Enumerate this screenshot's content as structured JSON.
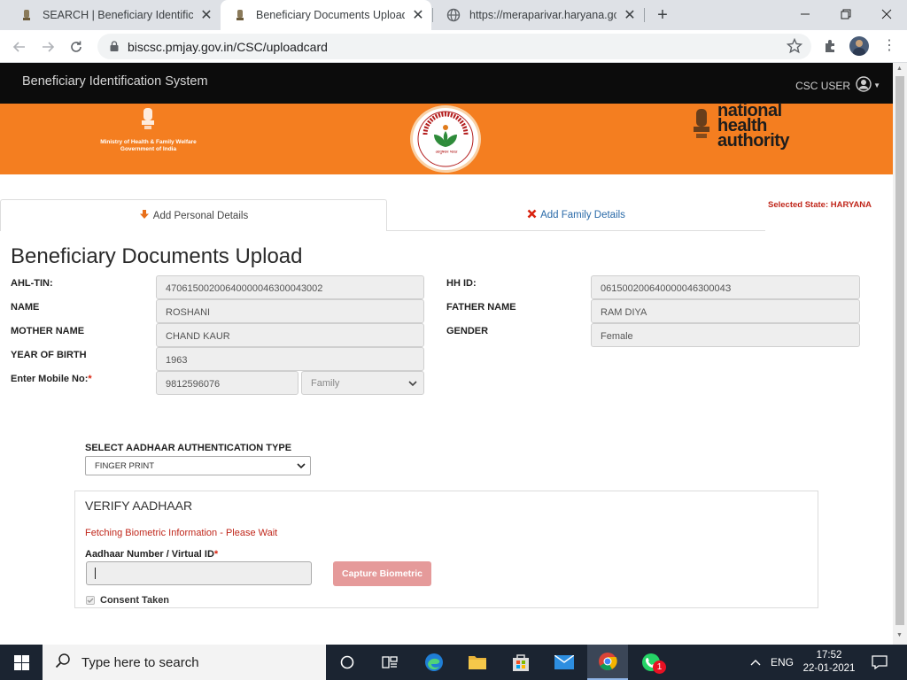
{
  "browser": {
    "tabs": [
      {
        "title": "SEARCH | Beneficiary Identificatio"
      },
      {
        "title": "Beneficiary Documents Upload | B"
      },
      {
        "title": "https://meraparivar.haryana.gov.i"
      }
    ],
    "url": "biscsc.pmjay.gov.in/CSC/uploadcard"
  },
  "app": {
    "brand": "Beneficiary Identification System",
    "user": "CSC USER",
    "banner": {
      "ministry_line1": "Ministry of Health & Family Welfare",
      "ministry_line2": "Government of India",
      "nha_line1": "national",
      "nha_line2": "health",
      "nha_line3": "authority",
      "seal_text": "प्रधानमंत्री जन आरोग्य योजना",
      "seal_bottom": "आयुष्मान भारत"
    },
    "selected_state_label": "Selected State: ",
    "selected_state_value": "HARYANA",
    "tabs": {
      "personal": "Add Personal Details",
      "family": "Add Family Details"
    },
    "page_title": "Beneficiary Documents Upload",
    "fields": {
      "ahl_tin_label": "AHL-TIN:",
      "ahl_tin_value": "47061500200640000046300043002",
      "hhid_label": "HH ID:",
      "hhid_value": "06150020064000004630004З",
      "name_label": "NAME",
      "name_value": "ROSHANI",
      "father_label": "FATHER NAME",
      "father_value": "RAM DIYA",
      "mother_label": "MOTHER NAME",
      "mother_value": "CHAND KAUR",
      "gender_label": "GENDER",
      "gender_value": "Female",
      "yob_label": "YEAR OF BIRTH",
      "yob_value": "1963",
      "mobile_label": "Enter Mobile No:",
      "mobile_value": "9812596076",
      "relation_value": "Family"
    },
    "auth": {
      "label": "SELECT AADHAAR AUTHENTICATION TYPE",
      "value": "FINGER PRINT"
    },
    "verify": {
      "title": "VERIFY AADHAAR",
      "status": "Fetching Biometric Information - Please Wait",
      "aadhaar_label": "Aadhaar Number / Virtual ID",
      "aadhaar_value": "",
      "capture_button": "Capture Biometric",
      "consent": "Consent Taken"
    },
    "colors": {
      "banner": "#f47e20",
      "navbar": "#0c0c0c",
      "required": "#d9230f",
      "capture_button": "#e59a9a"
    }
  },
  "taskbar": {
    "search_placeholder": "Type here to search",
    "lang": "ENG",
    "time": "17:52",
    "date": "22-01-2021",
    "whatsapp_badge": "1"
  }
}
